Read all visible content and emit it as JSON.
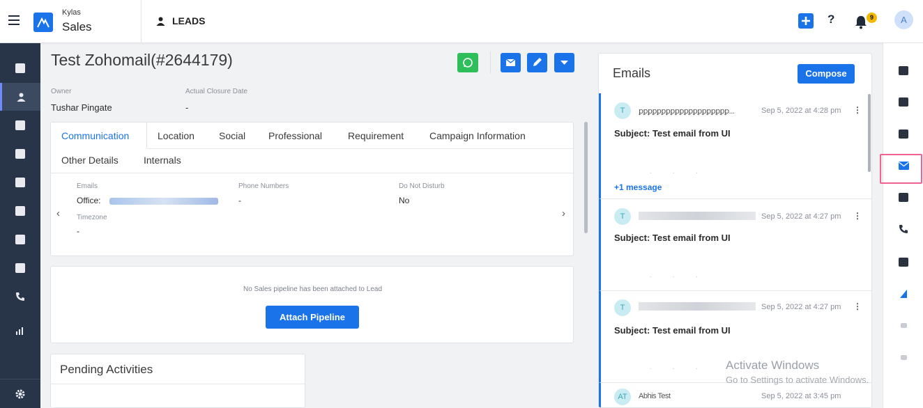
{
  "header": {
    "brand_small": "Kylas",
    "brand_big": "Sales",
    "module": "LEADS",
    "notification_count": "9",
    "avatar_initial": "A",
    "help": "?"
  },
  "lead": {
    "title": "Test Zohomail(#2644179)",
    "owner_label": "Owner",
    "owner_value": "Tushar Pingate",
    "closure_label": "Actual Closure Date",
    "closure_value": "-"
  },
  "tabs": [
    "Communication",
    "Location",
    "Social",
    "Professional",
    "Requirement",
    "Campaign Information",
    "Other Details",
    "Internals"
  ],
  "communication": {
    "emails_label": "Emails",
    "office_label": "Office:",
    "phone_label": "Phone Numbers",
    "phone_value": "-",
    "dnd_label": "Do Not Disturb",
    "dnd_value": "No",
    "timezone_label": "Timezone",
    "timezone_value": "-",
    "prev": "‹",
    "next": "›"
  },
  "pipeline": {
    "message": "No Sales pipeline has been attached to Lead",
    "button": "Attach Pipeline"
  },
  "pending": {
    "title": "Pending Activities"
  },
  "emails": {
    "title": "Emails",
    "compose": "Compose",
    "items": [
      {
        "avatar": "T",
        "sender": "ꝑꝑꝑꝑꝑꝑꝑꝑꝑꝑꝑꝑꝑꝑꝑꝑꝑꝑꝑꝑ...",
        "time": "Sep 5, 2022 at 4:28 pm",
        "subject": "Subject: Test email from UI",
        "more": "+1 message"
      },
      {
        "avatar": "T",
        "sender": "",
        "time": "Sep 5, 2022 at 4:27 pm",
        "subject": "Subject: Test email from UI"
      },
      {
        "avatar": "T",
        "sender": "",
        "time": "Sep 5, 2022 at 4:27 pm",
        "subject": "Subject: Test email from UI"
      },
      {
        "avatar": "AT",
        "sender": "Abhis Test",
        "time": "Sep 5, 2022 at 3:45 pm",
        "subject": ""
      }
    ]
  },
  "watermark": {
    "line1": "Activate Windows",
    "line2": "Go to Settings to activate Windows."
  },
  "colors": {
    "primary": "#1a73e8",
    "nav_bg": "#283447",
    "whatsapp": "#2fbf5a",
    "highlight": "#f06292",
    "badge": "#f5b800"
  }
}
